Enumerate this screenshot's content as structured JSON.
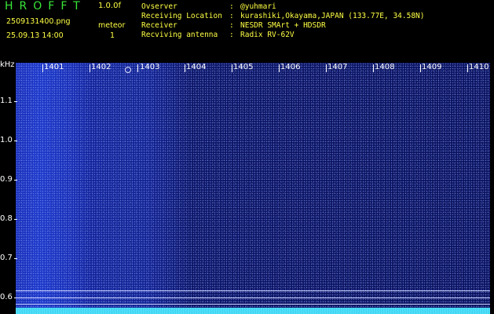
{
  "app": {
    "title": "HROFFT",
    "version": "1.0.0f",
    "filename": "2509131400.png",
    "datetime": "25.09.13 14:00",
    "meteor_label": "meteor",
    "meteor_count": "1"
  },
  "info": [
    {
      "label": "Ovserver",
      "value": "@yuhmari"
    },
    {
      "label": "Receiving Location",
      "value": "kurashiki,Okayama,JAPAN (133.77E, 34.58N)"
    },
    {
      "label": "Receiver",
      "value": "NESDR SMArt + HDSDR"
    },
    {
      "label": "Recviving antenna",
      "value": "Radix RV-62V"
    }
  ],
  "axis": {
    "unit": "kHz",
    "x_labels": [
      "1401",
      "1402",
      "1403",
      "1404",
      "1405",
      "1406",
      "1407",
      "1408",
      "1409",
      "1410"
    ],
    "y_labels": [
      "1.1",
      "1.0",
      "0.9",
      "0.8",
      "0.7",
      "0.6"
    ]
  },
  "colors": {
    "title": "#39e639",
    "info_text": "#ffff44",
    "axis_text": "#ffffff",
    "signal": "#2ad0f0"
  }
}
